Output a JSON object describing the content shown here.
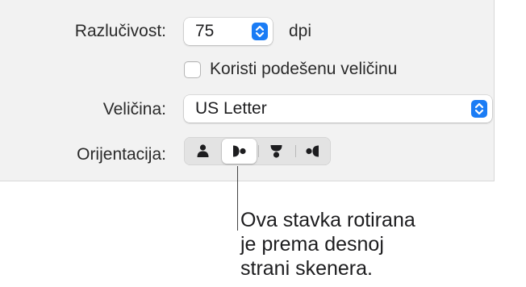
{
  "resolution": {
    "label": "Razlučivost:",
    "value": "75",
    "unit": "dpi"
  },
  "custom_size": {
    "label": "Koristi podešenu veličinu",
    "checked": false
  },
  "size": {
    "label": "Veličina:",
    "value": "US Letter"
  },
  "orientation": {
    "label": "Orijentacija:",
    "options": [
      {
        "icon": "portrait-upright-icon",
        "selected": false
      },
      {
        "icon": "rotated-right-icon",
        "selected": true
      },
      {
        "icon": "upside-down-icon",
        "selected": false
      },
      {
        "icon": "rotated-left-icon",
        "selected": false
      }
    ]
  },
  "callout": {
    "lines": [
      "Ova stavka rotirana",
      "je prema desnoj",
      "strani skenera."
    ]
  },
  "colors": {
    "accent": "#1a7cf5",
    "panel_background": "#f2f2f2"
  }
}
